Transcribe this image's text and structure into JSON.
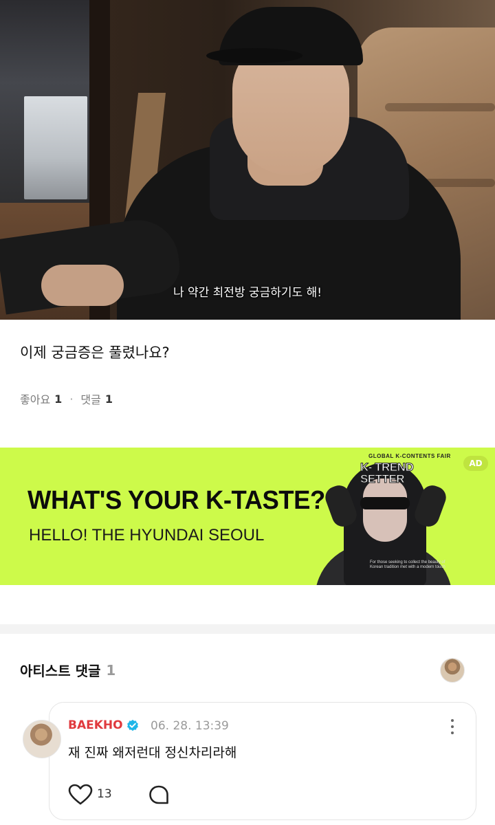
{
  "video": {
    "caption": "나 약간 최전방 궁금하기도 해!"
  },
  "post": {
    "title": "이제 궁금증은 풀렸나요?",
    "likes_label": "좋아요",
    "likes_count": "1",
    "separator": "·",
    "comments_label": "댓글",
    "comments_count": "1"
  },
  "ad": {
    "headline": "WHAT'S YOUR K-TASTE?",
    "subline": "HELLO! THE HYUNDAI SEOUL",
    "badge": "AD",
    "poster_top": "GLOBAL K-CONTENTS FAIR",
    "poster_title_1": "K- TREND",
    "poster_title_2": "SETTER",
    "poster_small": "For those seeking to collect the beauty of Korean tradition met with a modern touch",
    "background_color": "#cdfa4a"
  },
  "artist_comments": {
    "title": "아티스트 댓글",
    "count": "1"
  },
  "comment": {
    "author": "BAEKHO",
    "author_color": "#e03a3e",
    "verified_color": "#1fb6e8",
    "timestamp": "06. 28. 13:39",
    "text": "재 진짜 왜저런대 정신차리라해",
    "like_count": "13",
    "icons": [
      "heart-icon",
      "comment-bubble-icon",
      "more-vertical-icon",
      "verified-badge-icon"
    ]
  }
}
